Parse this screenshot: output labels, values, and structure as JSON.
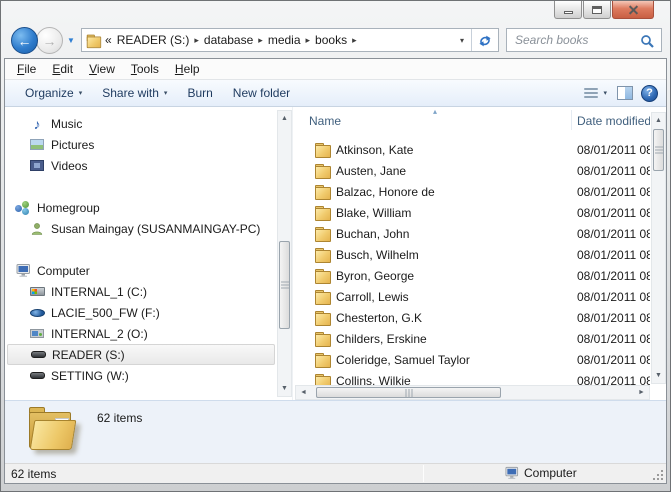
{
  "address_bar": {
    "prefix": "«",
    "crumbs": [
      "READER (S:)",
      "database",
      "media",
      "books"
    ],
    "separator": "▸"
  },
  "search": {
    "placeholder": "Search books"
  },
  "menu": [
    {
      "k": "F",
      "rest": "ile"
    },
    {
      "k": "E",
      "rest": "dit"
    },
    {
      "k": "V",
      "rest": "iew"
    },
    {
      "k": "T",
      "rest": "ools"
    },
    {
      "k": "H",
      "rest": "elp"
    }
  ],
  "toolbar": {
    "organize": "Organize",
    "share_with": "Share with",
    "burn": "Burn",
    "new_folder": "New folder"
  },
  "sidebar": {
    "library_items": [
      {
        "icon": "music-icon",
        "label": "Music"
      },
      {
        "icon": "pictures-icon",
        "label": "Pictures"
      },
      {
        "icon": "videos-icon",
        "label": "Videos"
      }
    ],
    "homegroup": {
      "label": "Homegroup",
      "member": "Susan Maingay (SUSANMAINGAY-PC)"
    },
    "computer": {
      "label": "Computer",
      "drives": [
        {
          "icon": "system-drive-icon",
          "label": "INTERNAL_1 (C:)"
        },
        {
          "icon": "lacie-drive-icon",
          "label": "LACIE_500_FW (F:)"
        },
        {
          "icon": "card-drive-icon",
          "label": "INTERNAL_2 (O:)"
        },
        {
          "icon": "drive-icon",
          "label": "READER (S:)",
          "selected": true
        },
        {
          "icon": "drive-icon",
          "label": "SETTING (W:)"
        }
      ]
    }
  },
  "file_list": {
    "columns": {
      "name": "Name",
      "date": "Date modified"
    },
    "rows": [
      {
        "name": "Atkinson, Kate",
        "date": "08/01/2011 08"
      },
      {
        "name": "Austen, Jane",
        "date": "08/01/2011 08"
      },
      {
        "name": "Balzac, Honore de",
        "date": "08/01/2011 08"
      },
      {
        "name": "Blake, William",
        "date": "08/01/2011 08"
      },
      {
        "name": "Buchan, John",
        "date": "08/01/2011 08"
      },
      {
        "name": "Busch, Wilhelm",
        "date": "08/01/2011 08"
      },
      {
        "name": "Byron, George",
        "date": "08/01/2011 08"
      },
      {
        "name": "Carroll, Lewis",
        "date": "08/01/2011 08"
      },
      {
        "name": "Chesterton, G.K",
        "date": "08/01/2011 08"
      },
      {
        "name": "Childers, Erskine",
        "date": "08/01/2011 08"
      },
      {
        "name": "Coleridge, Samuel Taylor",
        "date": "08/01/2011 08"
      },
      {
        "name": "Collins, Wilkie",
        "date": "08/01/2011 08"
      }
    ]
  },
  "details_pane": {
    "summary": "62 items"
  },
  "status_bar": {
    "items_count": "62 items",
    "location": "Computer"
  },
  "icons": {
    "back_arrow": "←",
    "forward_arrow": "→",
    "history_caret": "▼",
    "caret_down": "▾",
    "sort_asc": "▴",
    "scroll_up": "▲",
    "scroll_down": "▼",
    "scroll_left": "◄",
    "scroll_right": "►",
    "help_glyph": "?"
  },
  "colors": {
    "toolbar_text": "#1e3a5f",
    "header_text": "#41607e",
    "close_button": "#c95f43",
    "accent_blue": "#2f7ccc",
    "details_pane_bg": "#edf2f9"
  }
}
